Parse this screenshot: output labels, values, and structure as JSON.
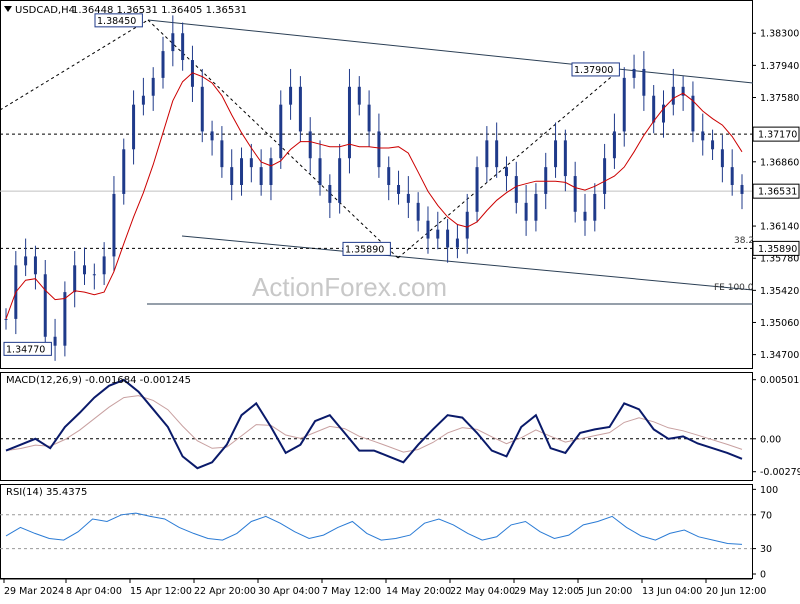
{
  "chart_data": {
    "type": "candlestick",
    "header": {
      "symbol": "USDCAD,H4",
      "ohlc": "1.36448 1.36531 1.36405 1.36531"
    },
    "watermark": "ActionForex.com",
    "x_tick_labels": [
      "29 Mar 2024",
      "8 Apr 04:00",
      "15 Apr 12:00",
      "22 Apr 20:00",
      "30 Apr 04:00",
      "7 May 12:00",
      "14 May 20:00",
      "22 May 04:00",
      "29 May 12:00",
      "5 Jun 20:00",
      "13 Jun 04:00",
      "20 Jun 12:00"
    ],
    "price_panel": {
      "y_tick_labels": [
        "1.38300",
        "1.37940",
        "1.37580",
        "1.36860",
        "1.36140",
        "1.35780",
        "1.35420",
        "1.35060",
        "1.34700"
      ],
      "ylim": [
        1.3455,
        1.3865
      ],
      "current_price": "1.36531",
      "levels": [
        {
          "label": "1.37170",
          "value": 1.3717,
          "style": "dashed"
        },
        {
          "label": "1.35890",
          "value": 1.3589,
          "style": "dashed"
        }
      ],
      "annotations": [
        {
          "text": "1.38450",
          "value": 1.3845
        },
        {
          "text": "1.37900",
          "value": 1.379
        },
        {
          "text": "1.35890",
          "value": 1.3589
        },
        {
          "text": "1.34770",
          "value": 1.3477
        },
        {
          "text": "38.2",
          "value": 1.3593
        },
        {
          "text": "FE 100.0",
          "value": 1.354
        }
      ],
      "ma_color": "#cc0000",
      "candle_color": "#1f3a8a",
      "close_series_sampled": [
        1.351,
        1.357,
        1.358,
        1.356,
        1.349,
        1.348,
        1.354,
        1.357,
        1.356,
        1.356,
        1.358,
        1.365,
        1.37,
        1.375,
        1.376,
        1.378,
        1.381,
        1.383,
        1.38,
        1.377,
        1.372,
        1.371,
        1.368,
        1.366,
        1.369,
        1.368,
        1.366,
        1.369,
        1.375,
        1.377,
        1.372,
        1.369,
        1.366,
        1.364,
        1.369,
        1.377,
        1.375,
        1.372,
        1.368,
        1.366,
        1.365,
        1.364,
        1.362,
        1.36,
        1.361,
        1.359,
        1.36,
        1.363,
        1.368,
        1.371,
        1.368,
        1.367,
        1.364,
        1.362,
        1.365,
        1.368,
        1.371,
        1.367,
        1.363,
        1.362,
        1.365,
        1.369,
        1.372,
        1.378,
        1.379,
        1.376,
        1.373,
        1.375,
        1.377,
        1.376,
        1.372,
        1.371,
        1.37,
        1.368,
        1.366,
        1.365
      ]
    },
    "macd_panel": {
      "title": "MACD(12,26,9) -0.001684 -0.001245",
      "y_tick_labels": [
        "0.005018",
        "0.00",
        "-0.002795"
      ],
      "ylim": [
        -0.0035,
        0.0055
      ],
      "series_sampled": [
        -0.001,
        -0.0005,
        0.0,
        -0.0008,
        0.001,
        0.0022,
        0.0035,
        0.0045,
        0.005,
        0.004,
        0.0025,
        0.001,
        -0.0015,
        -0.0025,
        -0.002,
        -0.0005,
        0.002,
        0.003,
        0.001,
        -0.0012,
        -0.0005,
        0.0015,
        0.002,
        0.0005,
        -0.001,
        -0.001,
        -0.0015,
        -0.002,
        -0.0005,
        0.0008,
        0.002,
        0.0018,
        0.0005,
        -0.001,
        -0.0015,
        0.001,
        0.002,
        -0.0008,
        -0.0012,
        0.0005,
        0.0008,
        0.001,
        0.003,
        0.0025,
        0.0008,
        0.0,
        0.0002,
        -0.0004,
        -0.0008,
        -0.0012,
        -0.0017
      ],
      "signal_color": "#c8a0a0",
      "macd_color": "#0a1a6a"
    },
    "rsi_panel": {
      "title": "RSI(14) 35.4375",
      "y_tick_labels": [
        "100",
        "70",
        "30",
        "0"
      ],
      "ylim": [
        0,
        100
      ],
      "levels": [
        70,
        30
      ],
      "series_sampled": [
        45,
        55,
        48,
        42,
        40,
        50,
        65,
        62,
        70,
        72,
        68,
        65,
        55,
        48,
        42,
        40,
        48,
        62,
        68,
        60,
        50,
        42,
        46,
        55,
        62,
        48,
        40,
        42,
        46,
        60,
        65,
        58,
        48,
        40,
        44,
        58,
        62,
        50,
        42,
        46,
        58,
        62,
        68,
        55,
        45,
        40,
        48,
        52,
        44,
        40,
        36,
        35
      ],
      "color": "#2a7bd5"
    }
  }
}
